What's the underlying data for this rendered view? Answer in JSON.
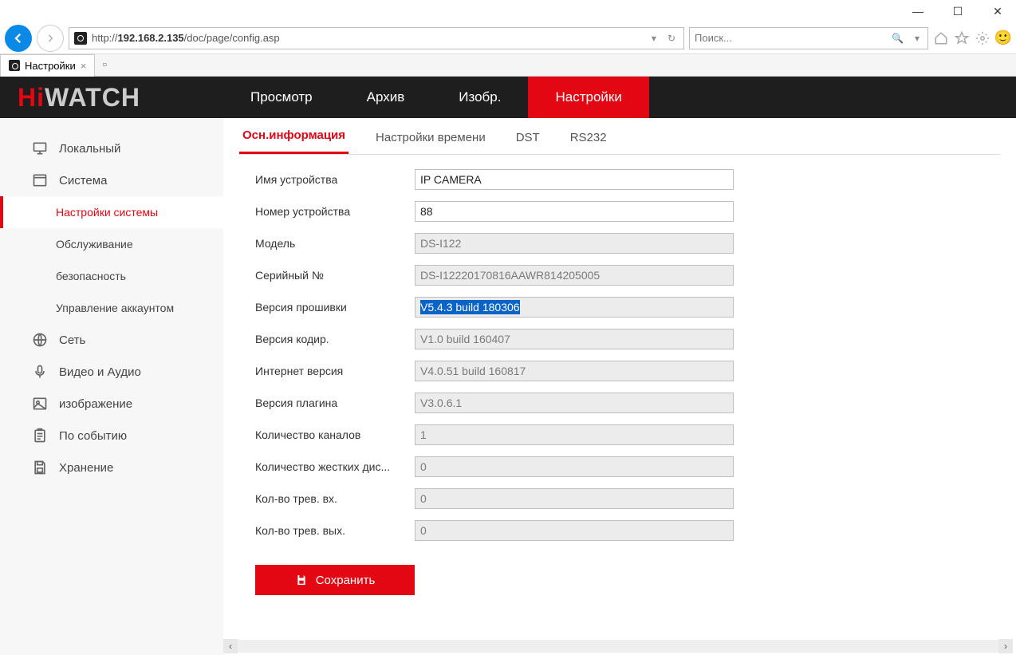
{
  "window": {
    "minimize": "—",
    "maximize": "☐",
    "close": "✕"
  },
  "browser": {
    "url_prefix": "http://",
    "url_host": "192.168.2.135",
    "url_path": "/doc/page/config.asp",
    "search_placeholder": "Поиск...",
    "tab_title": "Настройки"
  },
  "logo": {
    "hi": "Hi",
    "rest": "WATCH"
  },
  "topnav": {
    "items": [
      "Просмотр",
      "Архив",
      "Изобр.",
      "Настройки"
    ],
    "active_index": 3
  },
  "sidebar": {
    "items": [
      {
        "label": "Локальный",
        "icon": "monitor"
      },
      {
        "label": "Система",
        "icon": "window"
      },
      {
        "label": "Настройки системы",
        "sub": true,
        "active": true
      },
      {
        "label": "Обслуживание",
        "sub": true
      },
      {
        "label": "безопасность",
        "sub": true
      },
      {
        "label": "Управление аккаунтом",
        "sub": true
      },
      {
        "label": "Сеть",
        "icon": "globe"
      },
      {
        "label": "Видео и Аудио",
        "icon": "mic"
      },
      {
        "label": "изображение",
        "icon": "image"
      },
      {
        "label": "По событию",
        "icon": "clipboard"
      },
      {
        "label": "Хранение",
        "icon": "save"
      }
    ]
  },
  "subtabs": {
    "items": [
      "Осн.информация",
      "Настройки времени",
      "DST",
      "RS232"
    ],
    "active_index": 0
  },
  "form": {
    "rows": [
      {
        "label": "Имя устройства",
        "value": "IP CAMERA",
        "readonly": false
      },
      {
        "label": "Номер устройства",
        "value": "88",
        "readonly": false
      },
      {
        "label": "Модель",
        "value": "DS-I122",
        "readonly": true
      },
      {
        "label": "Серийный №",
        "value": "DS-I12220170816AAWR814205005",
        "readonly": true
      },
      {
        "label": "Версия прошивки",
        "value": "V5.4.3 build 180306",
        "readonly": true,
        "highlighted": true
      },
      {
        "label": "Версия кодир.",
        "value": "V1.0 build 160407",
        "readonly": true
      },
      {
        "label": "Интернет версия",
        "value": "V4.0.51 build 160817",
        "readonly": true
      },
      {
        "label": "Версия плагина",
        "value": "V3.0.6.1",
        "readonly": true
      },
      {
        "label": "Количество каналов",
        "value": "1",
        "readonly": true
      },
      {
        "label": "Количество жестких дис...",
        "value": "0",
        "readonly": true
      },
      {
        "label": "Кол-во трев. вх.",
        "value": "0",
        "readonly": true
      },
      {
        "label": "Кол-во трев. вых.",
        "value": "0",
        "readonly": true
      }
    ]
  },
  "buttons": {
    "save": "Сохранить"
  }
}
